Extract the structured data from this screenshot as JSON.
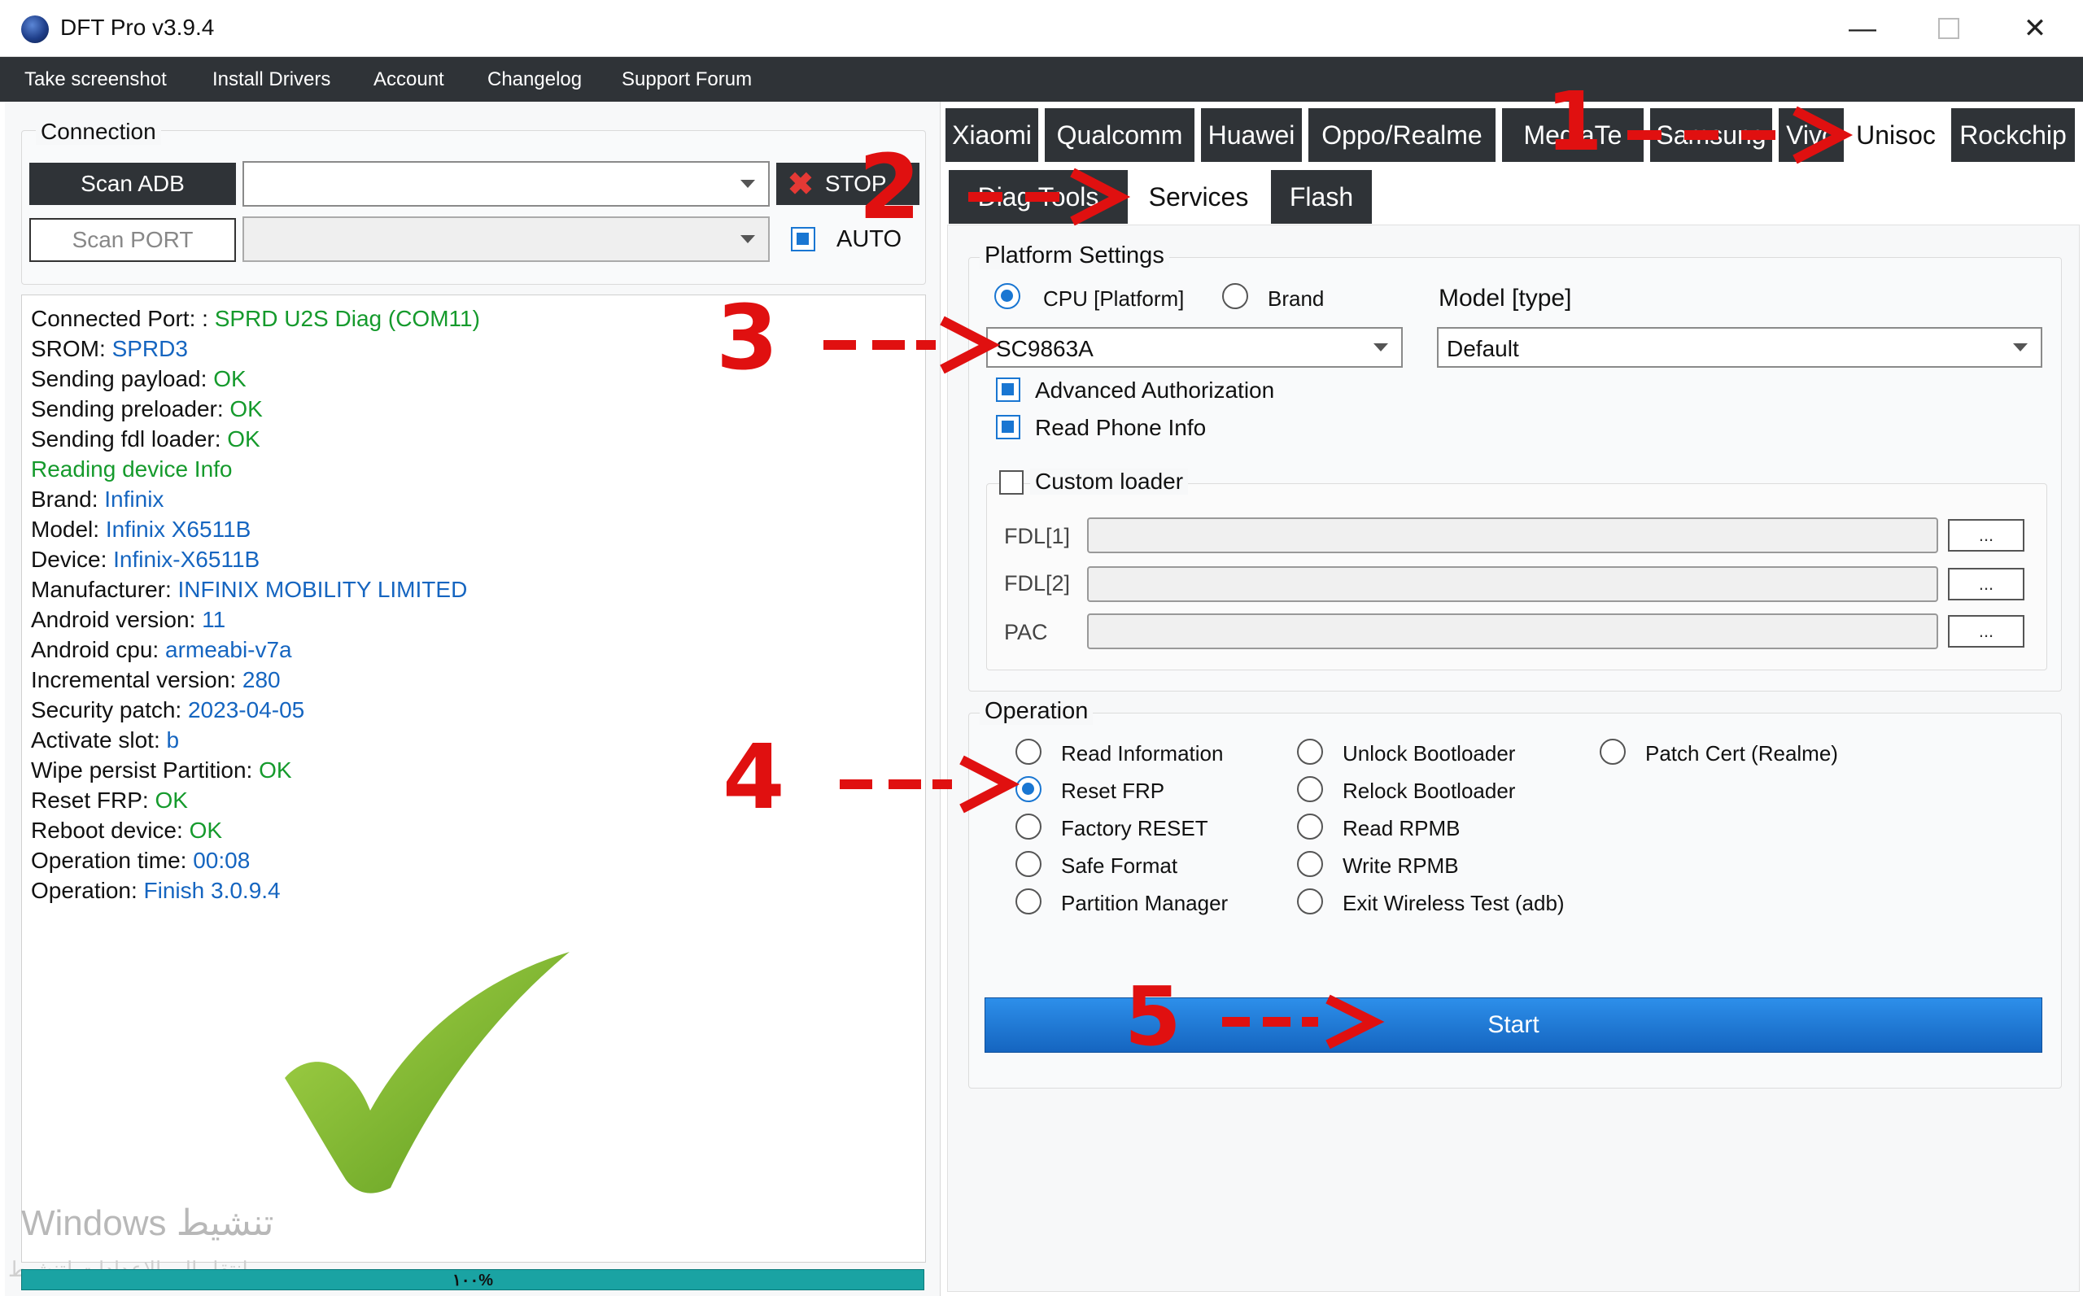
{
  "window": {
    "title": "DFT Pro v3.9.4"
  },
  "menu": [
    "Take screenshot",
    "Install Drivers",
    "Account",
    "Changelog",
    "Support Forum"
  ],
  "connection": {
    "title": "Connection",
    "scan_adb": "Scan ADB",
    "scan_port": "Scan PORT",
    "stop": "STOP",
    "auto": "AUTO",
    "auto_checked": true
  },
  "log": [
    {
      "label": "Connected Port: : ",
      "value": "SPRD U2S Diag (COM11)",
      "color": "green"
    },
    {
      "label": "SROM: ",
      "value": "SPRD3",
      "color": "blue"
    },
    {
      "label": "Sending payload: ",
      "value": "OK",
      "color": "green"
    },
    {
      "label": "Sending preloader: ",
      "value": "OK",
      "color": "green"
    },
    {
      "label": "Sending fdl loader: ",
      "value": "OK",
      "color": "green"
    },
    {
      "label": "",
      "value": "Reading device Info",
      "color": "green"
    },
    {
      "label": "Brand: ",
      "value": "Infinix",
      "color": "blue"
    },
    {
      "label": "Model: ",
      "value": "Infinix X6511B",
      "color": "blue"
    },
    {
      "label": "Device: ",
      "value": "Infinix-X6511B",
      "color": "blue"
    },
    {
      "label": "Manufacturer: ",
      "value": "INFINIX MOBILITY LIMITED",
      "color": "blue"
    },
    {
      "label": "Android version: ",
      "value": "11",
      "color": "blue"
    },
    {
      "label": "Android cpu: ",
      "value": "armeabi-v7a",
      "color": "blue"
    },
    {
      "label": "Incremental version: ",
      "value": "280",
      "color": "blue"
    },
    {
      "label": "Security patch: ",
      "value": "2023-04-05",
      "color": "blue"
    },
    {
      "label": "Activate slot: ",
      "value": "b",
      "color": "blue"
    },
    {
      "label": "Wipe persist Partition: ",
      "value": "OK",
      "color": "green"
    },
    {
      "label": "Reset FRP: ",
      "value": "OK",
      "color": "green"
    },
    {
      "label": "Reboot device: ",
      "value": "OK",
      "color": "green"
    },
    {
      "label": "Operation time: ",
      "value": "00:08",
      "color": "blue"
    },
    {
      "label": "Operation: ",
      "value": "Finish 3.0.9.4",
      "color": "blue"
    }
  ],
  "watermark": {
    "line1": "Windows تنشيط",
    "line2": "انتقل إلى الإعدادات لتنشيط"
  },
  "progress": {
    "text": "١٠٠%",
    "value": 100
  },
  "brand_tabs": [
    "Xiaomi",
    "Qualcomm",
    "Huawei",
    "Oppo/Realme",
    "MediaTe",
    "Samsung",
    "Vivo",
    "Unisoc",
    "Rockchip"
  ],
  "active_brand_tab": "Unisoc",
  "sub_tabs": [
    "Diag Tools",
    "Services",
    "Flash"
  ],
  "active_sub_tab": "Services",
  "platform": {
    "title": "Platform Settings",
    "cpu_label": "CPU [Platform]",
    "brand_label": "Brand",
    "model_label": "Model [type]",
    "cpu_value": "SC9863A",
    "model_value": "Default",
    "advanced_auth": "Advanced Authorization",
    "read_phone_info": "Read Phone Info",
    "custom_loader": "Custom loader",
    "fdl1": "FDL[1]",
    "fdl2": "FDL[2]",
    "pac": "PAC",
    "browse": "..."
  },
  "operation": {
    "title": "Operation",
    "col1": [
      "Read Information",
      "Reset FRP",
      "Factory RESET",
      "Safe Format",
      "Partition Manager"
    ],
    "col2": [
      "Unlock Bootloader",
      "Relock Bootloader",
      "Read RPMB",
      "Write RPMB",
      "Exit Wireless Test (adb)"
    ],
    "col3": [
      "Patch Cert (Realme)"
    ],
    "selected": "Reset FRP",
    "start": "Start"
  },
  "annotations": {
    "step1": "1",
    "step2": "2",
    "step3": "3",
    "step4": "4",
    "step5": "5",
    "color": "#e01010"
  },
  "colors": {
    "accent": "#1976d2",
    "dark_tab": "#2f3337",
    "ok_green": "#159a2c",
    "value_blue": "#1565c0"
  }
}
